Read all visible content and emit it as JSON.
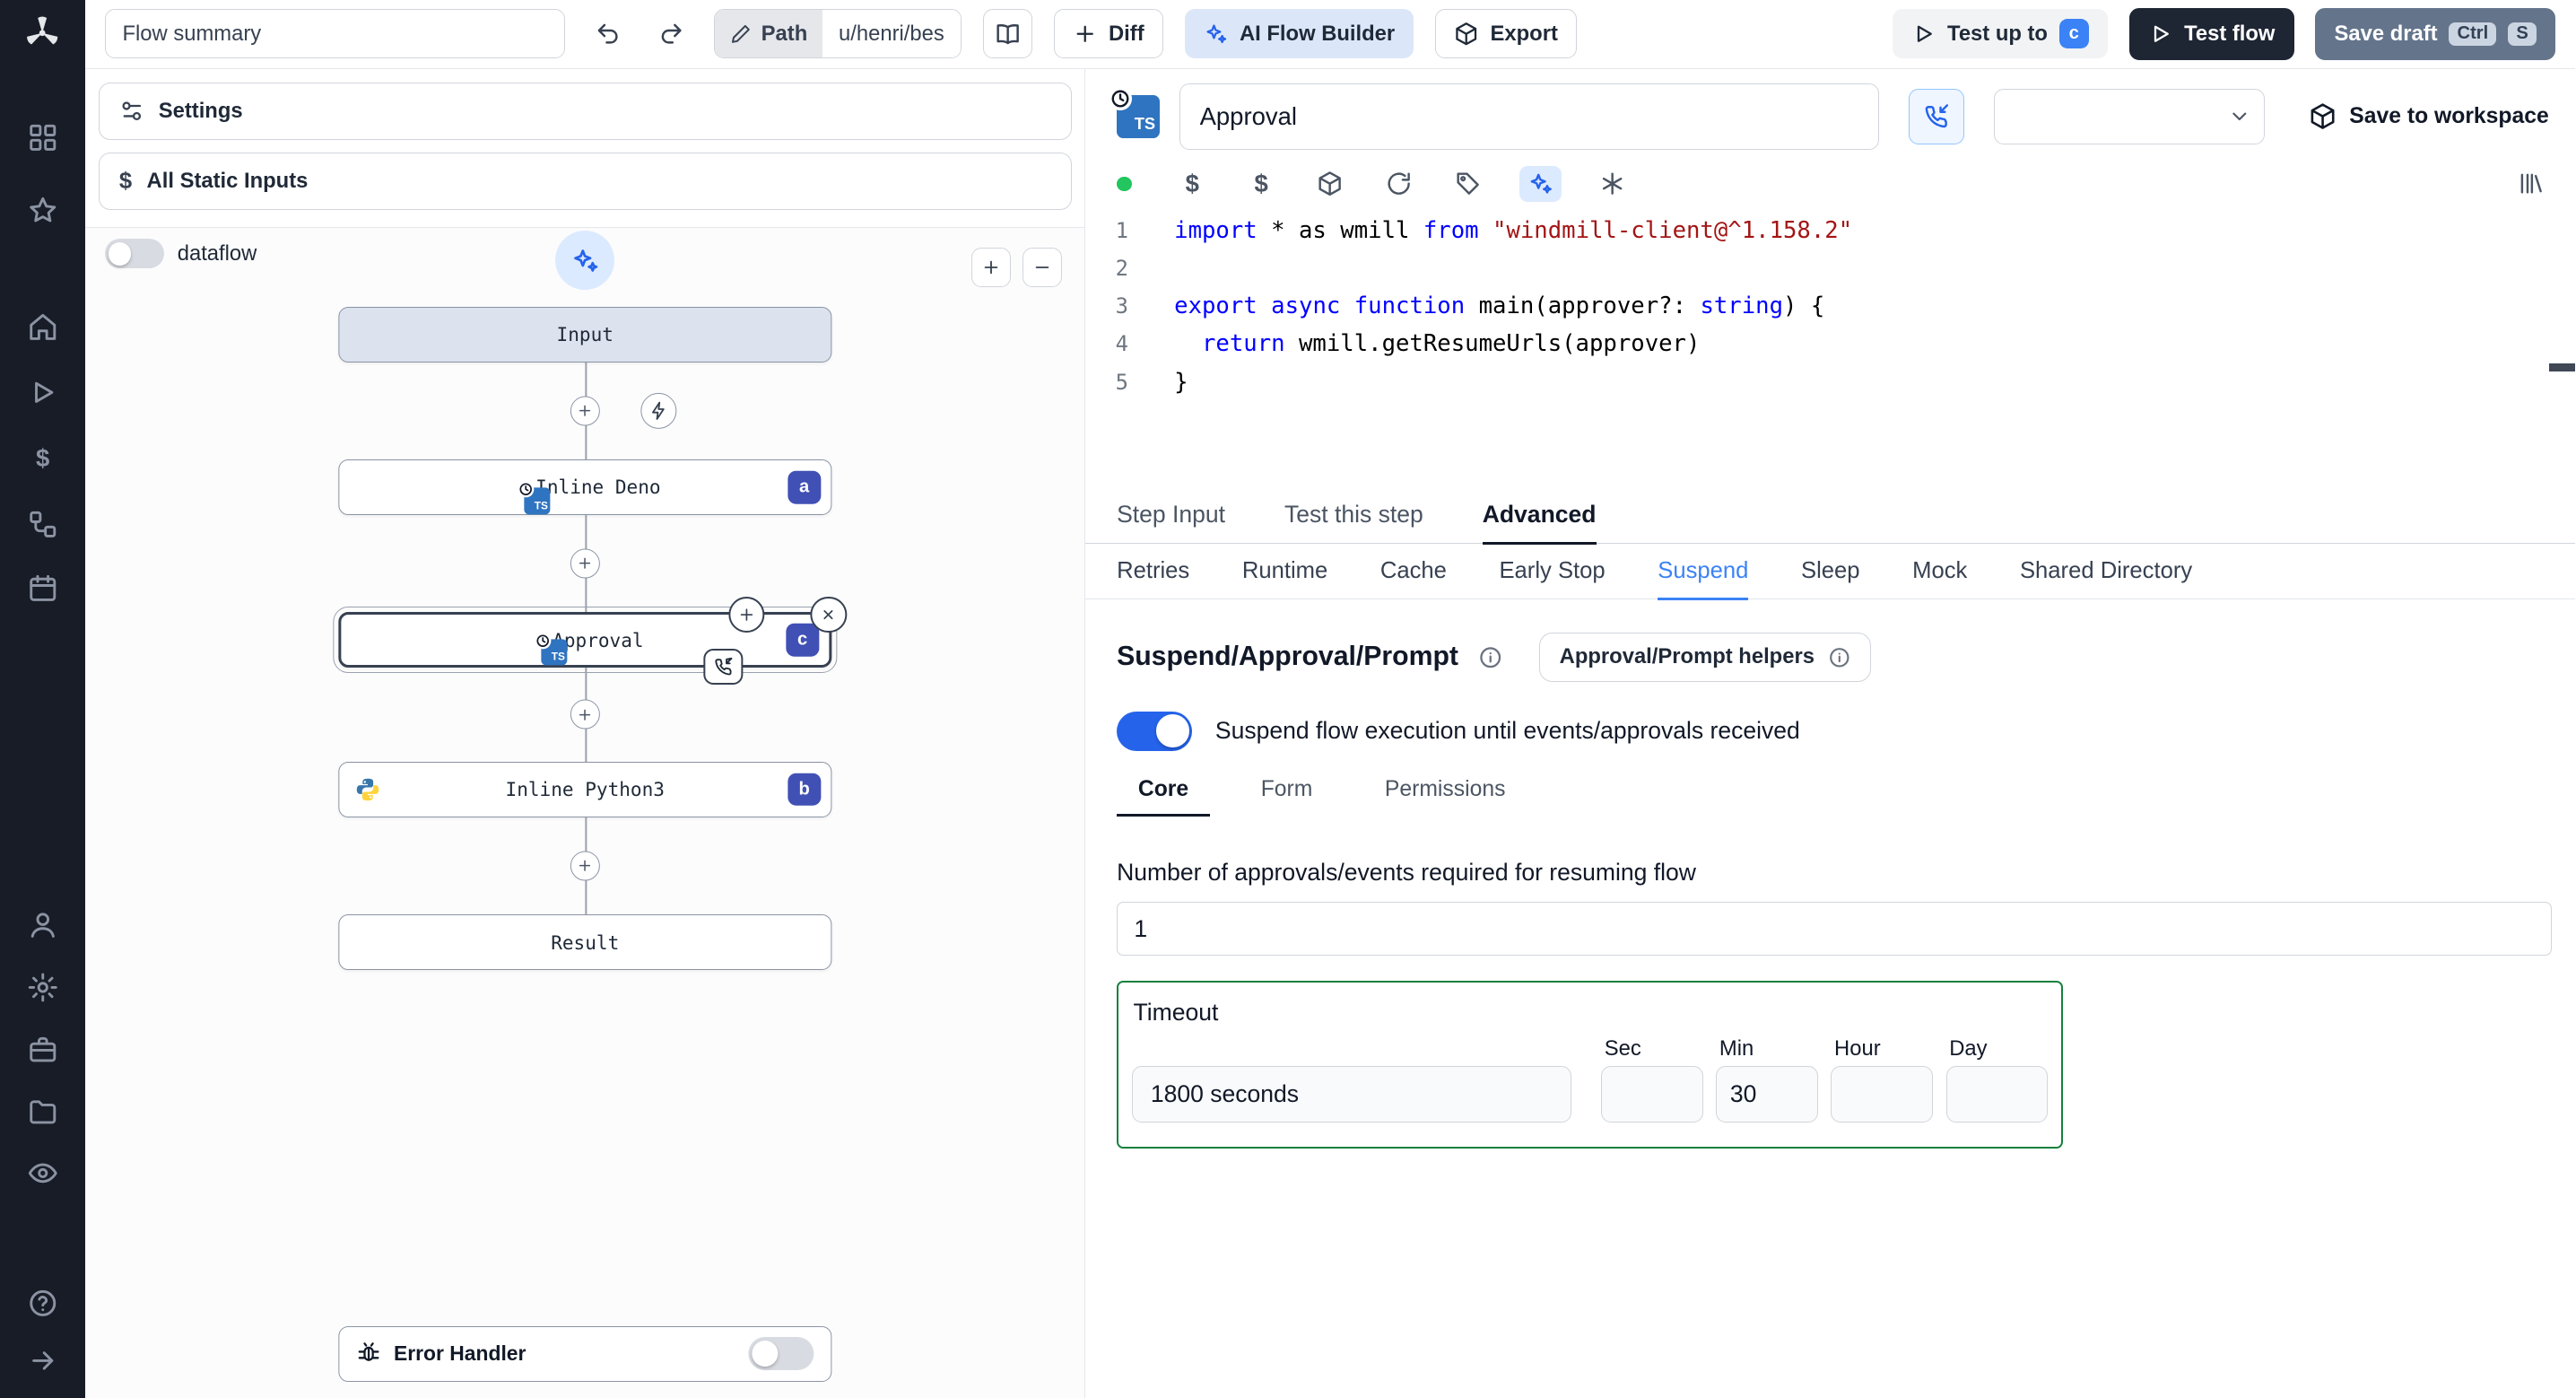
{
  "colors": {
    "accent_blue": "#2563eb",
    "suspend_tab_blue": "#3b82f6",
    "timeout_border_green": "#15803d",
    "ts_icon_blue": "#2f74c0",
    "status_green": "#22c55e",
    "test_flow_button": "#1e2533",
    "save_draft_button": "#64748b",
    "node_badge_indigo": "#4150b5"
  },
  "icons": {
    "ts_label": "TS",
    "sidebar": [
      "windmill-logo",
      "grid",
      "star",
      "home",
      "play",
      "dollar",
      "workflow",
      "calendar",
      "user",
      "gear",
      "briefcase",
      "folder",
      "eye",
      "help",
      "arrow-right"
    ],
    "editor_toolbar": [
      "status-dot",
      "dollar",
      "dollar",
      "package",
      "refresh",
      "tag",
      "magic-wand",
      "asterisk",
      "library"
    ]
  },
  "topbar": {
    "flow_summary_value": "Flow summary",
    "path_label": "Path",
    "path_value": "u/henri/bes",
    "diff_label": "Diff",
    "ai_builder_label": "AI Flow Builder",
    "export_label": "Export",
    "test_up_to_label": "Test up to",
    "test_up_to_badge": "c",
    "test_flow_label": "Test flow",
    "save_draft_label": "Save draft",
    "save_draft_keys": [
      "Ctrl",
      "S"
    ]
  },
  "flow_panel": {
    "settings_label": "Settings",
    "static_inputs_label": "All Static Inputs",
    "dataflow_label": "dataflow",
    "input_node_label": "Input",
    "result_node_label": "Result",
    "steps": [
      {
        "label": "Inline Deno",
        "badge": "a"
      },
      {
        "label": "Approval",
        "badge": "c"
      },
      {
        "label": "Inline Python3",
        "badge": "b"
      }
    ],
    "error_handler_label": "Error Handler"
  },
  "editor": {
    "step_title": "Approval",
    "save_to_workspace_label": "Save to workspace",
    "code": {
      "lines": [
        [
          {
            "t": "import",
            "c": "kw"
          },
          {
            "t": " * as wmill ",
            "c": "pl"
          },
          {
            "t": "from",
            "c": "kw"
          },
          {
            "t": " ",
            "c": "pl"
          },
          {
            "t": "\"windmill-client@^1.158.2\"",
            "c": "str"
          }
        ],
        [],
        [
          {
            "t": "export",
            "c": "kw"
          },
          {
            "t": " ",
            "c": "pl"
          },
          {
            "t": "async",
            "c": "kw"
          },
          {
            "t": " ",
            "c": "pl"
          },
          {
            "t": "function",
            "c": "kw"
          },
          {
            "t": " main(approver?: ",
            "c": "pl"
          },
          {
            "t": "string",
            "c": "kw"
          },
          {
            "t": ") {",
            "c": "pl"
          }
        ],
        [
          {
            "t": "  ",
            "c": "pl"
          },
          {
            "t": "return",
            "c": "kw"
          },
          {
            "t": " wmill.getResumeUrls(approver)",
            "c": "pl"
          }
        ],
        [
          {
            "t": "}",
            "c": "pl"
          }
        ]
      ]
    },
    "tabs": [
      "Step Input",
      "Test this step",
      "Advanced"
    ],
    "active_tab": "Advanced",
    "advanced_tabs": [
      "Retries",
      "Runtime",
      "Cache",
      "Early Stop",
      "Suspend",
      "Sleep",
      "Mock",
      "Shared Directory"
    ],
    "active_advanced_tab": "Suspend",
    "suspend": {
      "title": "Suspend/Approval/Prompt",
      "helpers_button_label": "Approval/Prompt helpers",
      "toggle_label": "Suspend flow execution until events/approvals received",
      "toggle_on": true,
      "subtabs": [
        "Core",
        "Form",
        "Permissions"
      ],
      "active_subtab": "Core",
      "approvals_label": "Number of approvals/events required for resuming flow",
      "approvals_value": "1",
      "timeout": {
        "label": "Timeout",
        "summary_value": "1800 seconds",
        "fields": [
          {
            "label": "Sec",
            "value": ""
          },
          {
            "label": "Min",
            "value": "30"
          },
          {
            "label": "Hour",
            "value": ""
          },
          {
            "label": "Day",
            "value": ""
          }
        ]
      }
    }
  }
}
